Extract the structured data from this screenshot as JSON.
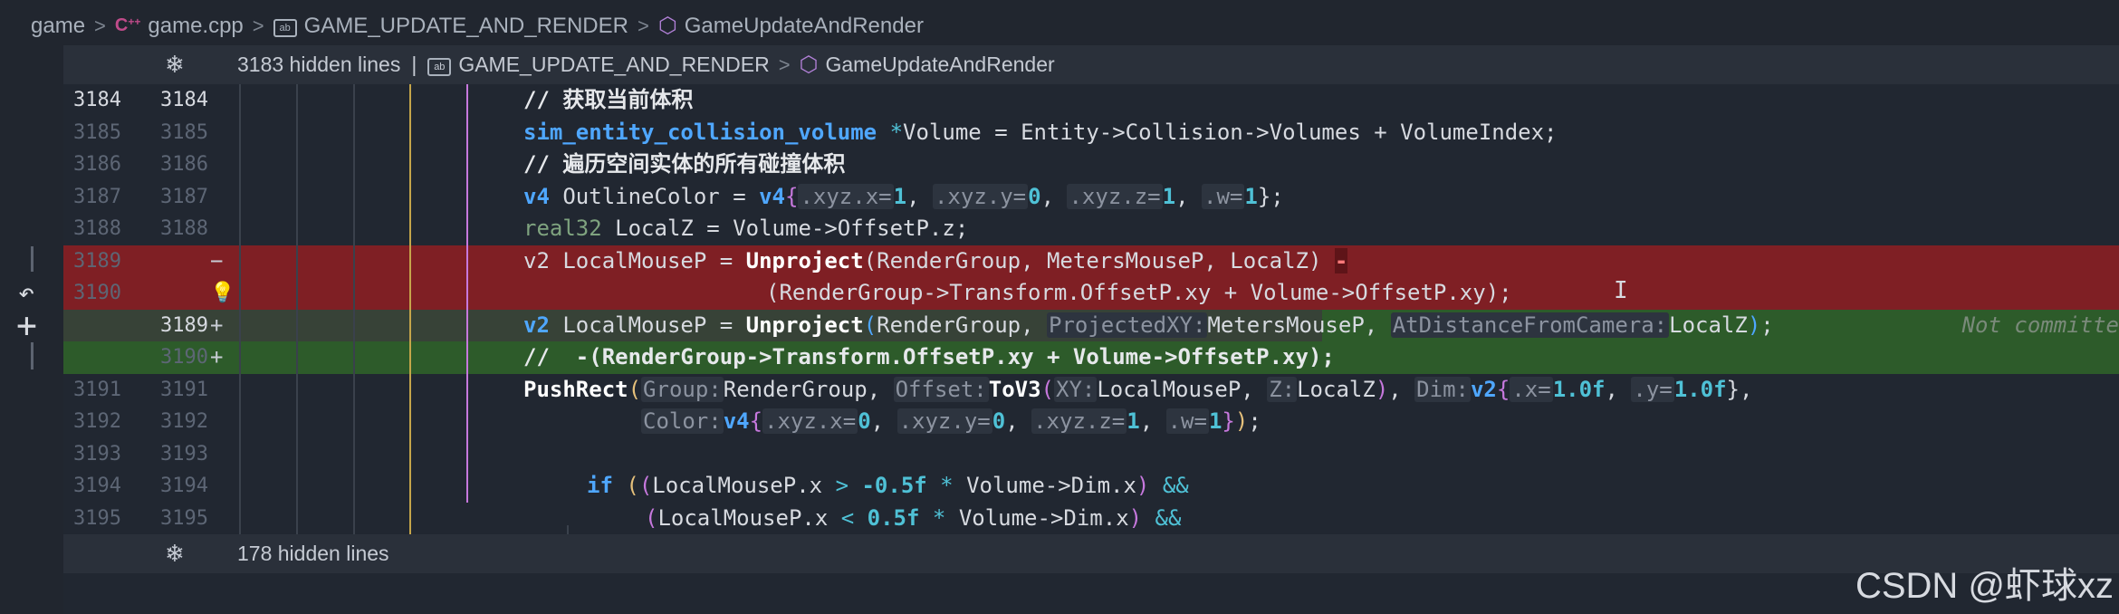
{
  "breadcrumb": {
    "items": [
      "game",
      "game.cpp",
      "GAME_UPDATE_AND_RENDER",
      "GameUpdateAndRender"
    ],
    "sep": ">"
  },
  "hidden_top": {
    "label": "3183 hidden lines",
    "bar": "|",
    "scope": "GAME_UPDATE_AND_RENDER",
    "sep": ">",
    "fn": "GameUpdateAndRender"
  },
  "hidden_bottom": {
    "label": "178 hidden lines"
  },
  "lines": [
    {
      "n1": "3184",
      "n2": "3184"
    },
    {
      "n1": "3185",
      "n2": "3185"
    },
    {
      "n1": "3186",
      "n2": "3186"
    },
    {
      "n1": "3187",
      "n2": "3187"
    },
    {
      "n1": "3188",
      "n2": "3188"
    },
    {
      "n1": "3189",
      "n2": "",
      "mark": "−"
    },
    {
      "n1": "3190",
      "n2": ""
    },
    {
      "n1": "",
      "n2": "3189",
      "mark": "+"
    },
    {
      "n1": "",
      "n2": "3190",
      "mark": "+"
    },
    {
      "n1": "3191",
      "n2": "3191"
    },
    {
      "n1": "3192",
      "n2": "3192"
    },
    {
      "n1": "3193",
      "n2": "3193"
    },
    {
      "n1": "3194",
      "n2": "3194"
    },
    {
      "n1": "3195",
      "n2": "3195"
    }
  ],
  "code": {
    "c1": "// 获取当前体积",
    "c2": {
      "type": "sim_entity_collision_volume",
      "ptr": "*",
      "rest": "Volume = Entity->Collision->Volumes + VolumeIndex;"
    },
    "c3": "// 遍历空间实体的所有碰撞体积",
    "c4": {
      "type": "v4",
      "name": " OutlineColor = ",
      "ctor": "v4",
      "a1": ".xyz.x=",
      "v1": "1",
      "a2": ".xyz.y=",
      "v2": "0",
      "a3": ".xyz.z=",
      "v3": "1",
      "a4": ".w=",
      "v4": "1",
      "end": "};"
    },
    "c5": {
      "type": "real32",
      "rest": " LocalZ = Volume->OffsetP.z;"
    },
    "c6": {
      "text": "v2 LocalMouseP = ",
      "fn": "Unproject",
      "args": "(RenderGroup, MetersMouseP, LocalZ) ",
      "op": "-"
    },
    "c7": "(RenderGroup->Transform.OffsetP.xy + Volume->OffsetP.xy);",
    "c8": {
      "type": "v2",
      "name": " LocalMouseP = ",
      "fn": "Unproject",
      "a0": "RenderGroup, ",
      "h1": "ProjectedXY:",
      "a1": "MetersMouseP, ",
      "h2": "AtDistanceFromCamera:",
      "a2": "LocalZ",
      "end": ";",
      "ghost": "Not committe"
    },
    "c9": "//  -(RenderGroup->Transform.OffsetP.xy + Volume->OffsetP.xy);",
    "c10": {
      "fn": "PushRect",
      "h1": "Group:",
      "a1": "RenderGroup, ",
      "h2": "Offset:",
      "fn2": "ToV3",
      "h3": "XY:",
      "a3": "LocalMouseP, ",
      "h4": "Z:",
      "a4": "LocalZ",
      "h5": "Dim:",
      "ty": "v2",
      "h6": ".x=",
      "v6": "1.0f",
      "h7": ".y=",
      "v7": "1.0f",
      "end": "},"
    },
    "c11": {
      "h1": "Color:",
      "ty": "v4",
      "a1": ".xyz.x=",
      "v1": "0",
      "a2": ".xyz.y=",
      "v2": "0",
      "a3": ".xyz.z=",
      "v3": "1",
      "a4": ".w=",
      "v4": "1",
      "end": ";"
    },
    "c13": {
      "kw": "if",
      "a": "LocalMouseP.x ",
      "op": ">",
      "n": " -0.5f",
      "op2": " * ",
      "b": "Volume->Dim.x",
      "and": " &&"
    },
    "c14": {
      "a": "LocalMouseP.x ",
      "op": "<",
      "n": " 0.5f",
      "op2": " * ",
      "b": "Volume->Dim.x",
      "and": " &&"
    }
  },
  "icons": [
    "cpp-file-icon",
    "namespace-icon",
    "function-cube-icon",
    "unfold-icon",
    "revert-icon",
    "add-icon",
    "lightbulb-icon",
    "text-cursor-icon"
  ],
  "watermark": "CSDN @虾球xz"
}
